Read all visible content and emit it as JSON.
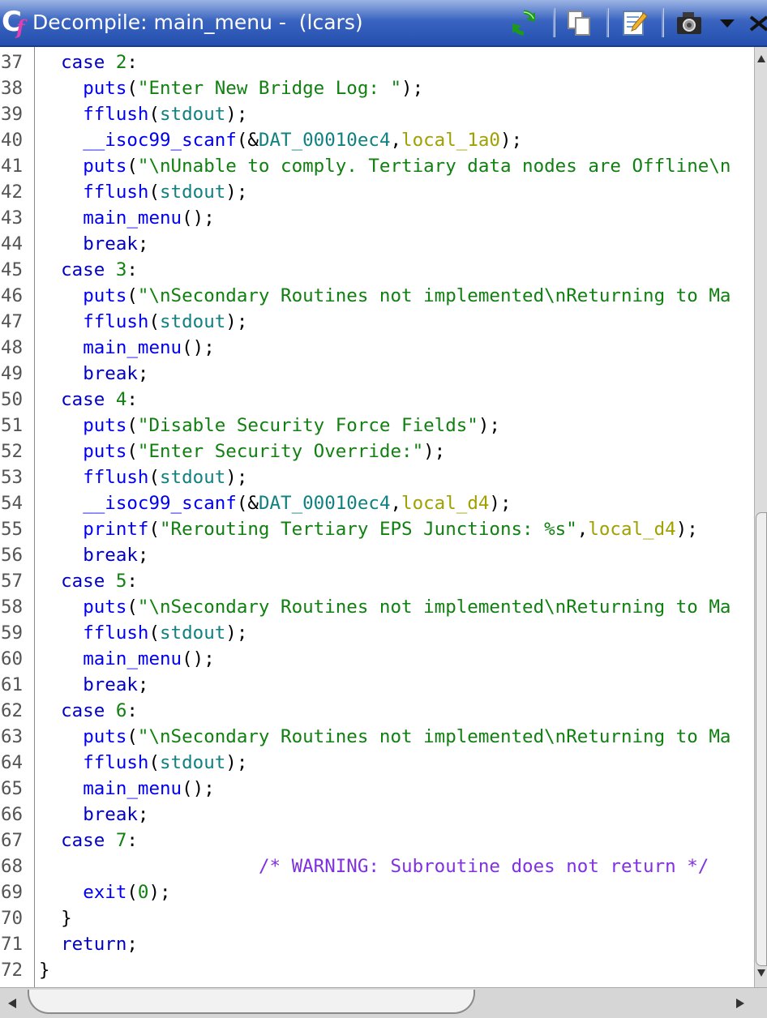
{
  "window": {
    "title": "Decompile: main_menu -  (lcars)",
    "icons": [
      "decompiler-icon",
      "refresh-icon",
      "copy-icon",
      "edit-icon",
      "snapshot-icon",
      "menu-dropdown-icon",
      "close-icon"
    ]
  },
  "line_numbers": [
    "37",
    "38",
    "39",
    "40",
    "41",
    "42",
    "43",
    "44",
    "45",
    "46",
    "47",
    "48",
    "49",
    "50",
    "51",
    "52",
    "53",
    "54",
    "55",
    "56",
    "57",
    "58",
    "59",
    "60",
    "61",
    "62",
    "63",
    "64",
    "65",
    "66",
    "67",
    "68",
    "69",
    "70",
    "71",
    "72"
  ],
  "code": [
    {
      "indent": "  ",
      "tokens": [
        {
          "t": "kw",
          "v": "case "
        },
        {
          "t": "num",
          "v": "2"
        },
        {
          "t": "p",
          "v": ":"
        }
      ]
    },
    {
      "indent": "    ",
      "tokens": [
        {
          "t": "fn",
          "v": "puts"
        },
        {
          "t": "p",
          "v": "("
        },
        {
          "t": "str",
          "v": "\"Enter New Bridge Log: \""
        },
        {
          "t": "p",
          "v": ");"
        }
      ]
    },
    {
      "indent": "    ",
      "tokens": [
        {
          "t": "fn",
          "v": "fflush"
        },
        {
          "t": "p",
          "v": "("
        },
        {
          "t": "gbl",
          "v": "stdout"
        },
        {
          "t": "p",
          "v": ");"
        }
      ]
    },
    {
      "indent": "    ",
      "tokens": [
        {
          "t": "fn",
          "v": "__isoc99_scanf"
        },
        {
          "t": "p",
          "v": "(&"
        },
        {
          "t": "gbl",
          "v": "DAT_00010ec4"
        },
        {
          "t": "p",
          "v": ","
        },
        {
          "t": "lcl",
          "v": "local_1a0"
        },
        {
          "t": "p",
          "v": ");"
        }
      ]
    },
    {
      "indent": "    ",
      "tokens": [
        {
          "t": "fn",
          "v": "puts"
        },
        {
          "t": "p",
          "v": "("
        },
        {
          "t": "str",
          "v": "\"\\nUnable to comply. Tertiary data nodes are Offline\\n"
        }
      ]
    },
    {
      "indent": "    ",
      "tokens": [
        {
          "t": "fn",
          "v": "fflush"
        },
        {
          "t": "p",
          "v": "("
        },
        {
          "t": "gbl",
          "v": "stdout"
        },
        {
          "t": "p",
          "v": ");"
        }
      ]
    },
    {
      "indent": "    ",
      "tokens": [
        {
          "t": "fn",
          "v": "main_menu"
        },
        {
          "t": "p",
          "v": "();"
        }
      ]
    },
    {
      "indent": "    ",
      "tokens": [
        {
          "t": "kw",
          "v": "break"
        },
        {
          "t": "p",
          "v": ";"
        }
      ]
    },
    {
      "indent": "  ",
      "tokens": [
        {
          "t": "kw",
          "v": "case "
        },
        {
          "t": "num",
          "v": "3"
        },
        {
          "t": "p",
          "v": ":"
        }
      ]
    },
    {
      "indent": "    ",
      "tokens": [
        {
          "t": "fn",
          "v": "puts"
        },
        {
          "t": "p",
          "v": "("
        },
        {
          "t": "str",
          "v": "\"\\nSecondary Routines not implemented\\nReturning to Ma"
        }
      ]
    },
    {
      "indent": "    ",
      "tokens": [
        {
          "t": "fn",
          "v": "fflush"
        },
        {
          "t": "p",
          "v": "("
        },
        {
          "t": "gbl",
          "v": "stdout"
        },
        {
          "t": "p",
          "v": ");"
        }
      ]
    },
    {
      "indent": "    ",
      "tokens": [
        {
          "t": "fn",
          "v": "main_menu"
        },
        {
          "t": "p",
          "v": "();"
        }
      ]
    },
    {
      "indent": "    ",
      "tokens": [
        {
          "t": "kw",
          "v": "break"
        },
        {
          "t": "p",
          "v": ";"
        }
      ]
    },
    {
      "indent": "  ",
      "tokens": [
        {
          "t": "kw",
          "v": "case "
        },
        {
          "t": "num",
          "v": "4"
        },
        {
          "t": "p",
          "v": ":"
        }
      ]
    },
    {
      "indent": "    ",
      "tokens": [
        {
          "t": "fn",
          "v": "puts"
        },
        {
          "t": "p",
          "v": "("
        },
        {
          "t": "str",
          "v": "\"Disable Security Force Fields\""
        },
        {
          "t": "p",
          "v": ");"
        }
      ]
    },
    {
      "indent": "    ",
      "tokens": [
        {
          "t": "fn",
          "v": "puts"
        },
        {
          "t": "p",
          "v": "("
        },
        {
          "t": "str",
          "v": "\"Enter Security Override:\""
        },
        {
          "t": "p",
          "v": ");"
        }
      ]
    },
    {
      "indent": "    ",
      "tokens": [
        {
          "t": "fn",
          "v": "fflush"
        },
        {
          "t": "p",
          "v": "("
        },
        {
          "t": "gbl",
          "v": "stdout"
        },
        {
          "t": "p",
          "v": ");"
        }
      ]
    },
    {
      "indent": "    ",
      "tokens": [
        {
          "t": "fn",
          "v": "__isoc99_scanf"
        },
        {
          "t": "p",
          "v": "(&"
        },
        {
          "t": "gbl",
          "v": "DAT_00010ec4"
        },
        {
          "t": "p",
          "v": ","
        },
        {
          "t": "lcl",
          "v": "local_d4"
        },
        {
          "t": "p",
          "v": ");"
        }
      ]
    },
    {
      "indent": "    ",
      "tokens": [
        {
          "t": "fn",
          "v": "printf"
        },
        {
          "t": "p",
          "v": "("
        },
        {
          "t": "str",
          "v": "\"Rerouting Tertiary EPS Junctions: %s\""
        },
        {
          "t": "p",
          "v": ","
        },
        {
          "t": "lcl",
          "v": "local_d4"
        },
        {
          "t": "p",
          "v": ");"
        }
      ]
    },
    {
      "indent": "    ",
      "tokens": [
        {
          "t": "kw",
          "v": "break"
        },
        {
          "t": "p",
          "v": ";"
        }
      ]
    },
    {
      "indent": "  ",
      "tokens": [
        {
          "t": "kw",
          "v": "case "
        },
        {
          "t": "num",
          "v": "5"
        },
        {
          "t": "p",
          "v": ":"
        }
      ]
    },
    {
      "indent": "    ",
      "tokens": [
        {
          "t": "fn",
          "v": "puts"
        },
        {
          "t": "p",
          "v": "("
        },
        {
          "t": "str",
          "v": "\"\\nSecondary Routines not implemented\\nReturning to Ma"
        }
      ]
    },
    {
      "indent": "    ",
      "tokens": [
        {
          "t": "fn",
          "v": "fflush"
        },
        {
          "t": "p",
          "v": "("
        },
        {
          "t": "gbl",
          "v": "stdout"
        },
        {
          "t": "p",
          "v": ");"
        }
      ]
    },
    {
      "indent": "    ",
      "tokens": [
        {
          "t": "fn",
          "v": "main_menu"
        },
        {
          "t": "p",
          "v": "();"
        }
      ]
    },
    {
      "indent": "    ",
      "tokens": [
        {
          "t": "kw",
          "v": "break"
        },
        {
          "t": "p",
          "v": ";"
        }
      ]
    },
    {
      "indent": "  ",
      "tokens": [
        {
          "t": "kw",
          "v": "case "
        },
        {
          "t": "num",
          "v": "6"
        },
        {
          "t": "p",
          "v": ":"
        }
      ]
    },
    {
      "indent": "    ",
      "tokens": [
        {
          "t": "fn",
          "v": "puts"
        },
        {
          "t": "p",
          "v": "("
        },
        {
          "t": "str",
          "v": "\"\\nSecondary Routines not implemented\\nReturning to Ma"
        }
      ]
    },
    {
      "indent": "    ",
      "tokens": [
        {
          "t": "fn",
          "v": "fflush"
        },
        {
          "t": "p",
          "v": "("
        },
        {
          "t": "gbl",
          "v": "stdout"
        },
        {
          "t": "p",
          "v": ");"
        }
      ]
    },
    {
      "indent": "    ",
      "tokens": [
        {
          "t": "fn",
          "v": "main_menu"
        },
        {
          "t": "p",
          "v": "();"
        }
      ]
    },
    {
      "indent": "    ",
      "tokens": [
        {
          "t": "kw",
          "v": "break"
        },
        {
          "t": "p",
          "v": ";"
        }
      ]
    },
    {
      "indent": "  ",
      "tokens": [
        {
          "t": "kw",
          "v": "case "
        },
        {
          "t": "num",
          "v": "7"
        },
        {
          "t": "p",
          "v": ":"
        }
      ]
    },
    {
      "indent": "                    ",
      "tokens": [
        {
          "t": "cmt",
          "v": "/* WARNING: Subroutine does not return */"
        }
      ]
    },
    {
      "indent": "    ",
      "tokens": [
        {
          "t": "fn",
          "v": "exit"
        },
        {
          "t": "p",
          "v": "("
        },
        {
          "t": "num",
          "v": "0"
        },
        {
          "t": "p",
          "v": ");"
        }
      ]
    },
    {
      "indent": "  ",
      "tokens": [
        {
          "t": "p",
          "v": "}"
        }
      ]
    },
    {
      "indent": "  ",
      "tokens": [
        {
          "t": "kw",
          "v": "return"
        },
        {
          "t": "p",
          "v": ";"
        }
      ]
    },
    {
      "indent": "",
      "tokens": [
        {
          "t": "p",
          "v": "}"
        }
      ]
    }
  ],
  "colors": {
    "title_bar": "#2f5ab8",
    "keyword": "#0000c0",
    "function": "#0000f0",
    "string": "#108010",
    "global": "#108080",
    "local": "#a0a000",
    "comment": "#8030e0"
  }
}
